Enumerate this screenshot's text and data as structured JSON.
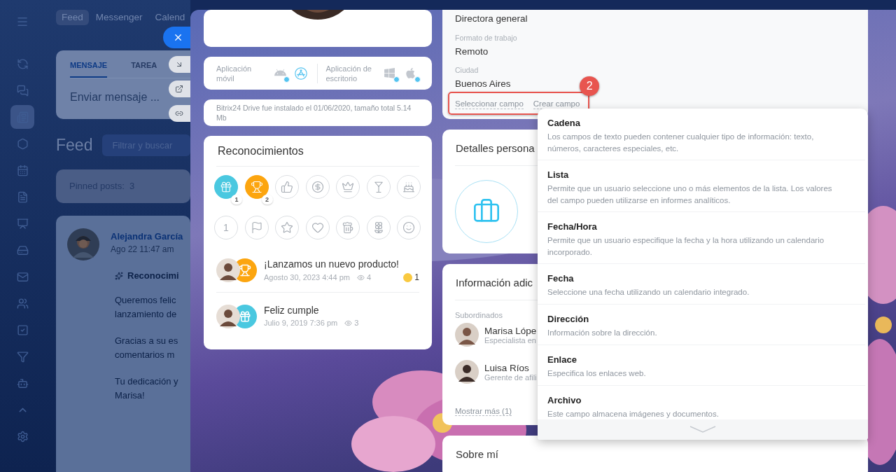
{
  "app": {
    "sidebar": [
      {
        "kind": "sync",
        "selected": false
      },
      {
        "kind": "chat",
        "selected": false
      },
      {
        "kind": "feed",
        "selected": true
      },
      {
        "kind": "hexagon",
        "selected": false
      },
      {
        "kind": "calendar",
        "selected": false
      },
      {
        "kind": "document",
        "selected": false
      },
      {
        "kind": "presentation",
        "selected": false
      },
      {
        "kind": "drive",
        "selected": false
      },
      {
        "kind": "mail",
        "selected": false
      },
      {
        "kind": "contacts",
        "selected": false
      },
      {
        "kind": "tasks",
        "selected": false
      },
      {
        "kind": "funnel",
        "selected": false
      },
      {
        "kind": "robot",
        "selected": false
      },
      {
        "kind": "more",
        "selected": false
      },
      {
        "kind": "settings",
        "selected": false
      }
    ],
    "top_tabs": [
      {
        "label": "Feed",
        "selected": true
      },
      {
        "label": "Messenger",
        "selected": false
      },
      {
        "label": "Calend",
        "selected": false
      }
    ],
    "composer": {
      "tabs": [
        {
          "label": "MENSAJE",
          "selected": true
        },
        {
          "label": "TAREA",
          "selected": false
        }
      ],
      "placeholder": "Enviar mensaje ..."
    },
    "feed_title": "Feed",
    "search": {
      "placeholder": "Filtrar y buscar"
    },
    "pinned": "Pinned posts:  3",
    "post": {
      "author": "Alejandra García",
      "time": "Ago 22 11:47 am",
      "heading": "Reconocimi",
      "paragraphs": [
        [
          "Queremos felic",
          "lanzamiento de"
        ],
        [
          "Gracias a su es",
          "comentarios m"
        ],
        [
          "Tu dedicación y",
          "Marisa!"
        ]
      ]
    }
  },
  "panel_actions": [
    {
      "kind": "close"
    },
    {
      "kind": "minimize"
    },
    {
      "kind": "new-window"
    },
    {
      "kind": "link"
    }
  ],
  "apps": [
    {
      "label": "Aplicación móvil",
      "platforms": [
        {
          "kind": "android"
        },
        {
          "kind": "appstore"
        }
      ]
    },
    {
      "label": "Aplicación de escritorio",
      "platforms": [
        {
          "kind": "windows"
        },
        {
          "kind": "apple"
        }
      ]
    }
  ],
  "drive_note": "Bitrix24 Drive fue instalado el 01/06/2020, tamaño total 5.14 Mb",
  "recognitions": {
    "title": "Reconocimientos",
    "badges": [
      {
        "kind": "gift",
        "earned": true,
        "count": "1"
      },
      {
        "kind": "trophy",
        "earned": true,
        "count": "2"
      },
      {
        "kind": "thumbs-up",
        "earned": false
      },
      {
        "kind": "money",
        "earned": false
      },
      {
        "kind": "crown",
        "earned": false
      },
      {
        "kind": "cocktail",
        "earned": false
      },
      {
        "kind": "cake",
        "earned": false
      },
      {
        "kind": "number",
        "earned": false,
        "glyph": "1"
      },
      {
        "kind": "flag",
        "earned": false
      },
      {
        "kind": "star",
        "earned": false
      },
      {
        "kind": "heart",
        "earned": false
      },
      {
        "kind": "beer",
        "earned": false
      },
      {
        "kind": "flower",
        "earned": false
      },
      {
        "kind": "smile",
        "earned": false
      }
    ],
    "items": [
      {
        "title": "¡Lanzamos un nuevo producto!",
        "kind": "trophy",
        "date": "Agosto 30, 2023 4:44 pm",
        "views": "4",
        "reactions": "1"
      },
      {
        "title": "Feliz cumple",
        "kind": "gift",
        "date": "Julio 9, 2019 7:36 pm",
        "views": "3"
      }
    ]
  },
  "info": {
    "position": "Directora general",
    "fields": [
      {
        "label": "Formato de trabajo",
        "value": "Remoto"
      },
      {
        "label": "Ciudad",
        "value": "Buenos Aires"
      }
    ],
    "links": [
      "Seleccionar campo",
      "Crear campo"
    ],
    "annotation": "2"
  },
  "personal_details": {
    "title": "Detalles persona"
  },
  "additional": {
    "title": "Información adic",
    "subtitle": "Subordinados",
    "people": [
      {
        "name": "Marisa Lópe",
        "role": "Especialista en"
      },
      {
        "name": "Luisa Ríos",
        "role": "Gerente de afili"
      }
    ],
    "more": "Mostrar más (1)"
  },
  "about": {
    "title": "Sobre mí"
  },
  "field_menu": [
    {
      "title": "Cadena",
      "description": "Los campos de texto pueden contener cualquier tipo de información: texto, números, caracteres especiales, etc."
    },
    {
      "title": "Lista",
      "description": "Permite que un usuario seleccione uno o más elementos de la lista. Los valores del campo pueden utilizarse en informes analíticos."
    },
    {
      "title": "Fecha/Hora",
      "description": "Permite que un usuario especifique la fecha y la hora utilizando un calendario incorporado."
    },
    {
      "title": "Fecha",
      "description": "Seleccione una fecha utilizando un calendario integrado."
    },
    {
      "title": "Dirección",
      "description": "Información sobre la dirección."
    },
    {
      "title": "Enlace",
      "description": "Especifica los enlaces web."
    },
    {
      "title": "Archivo",
      "description": "Este campo almacena imágenes y documentos."
    }
  ]
}
